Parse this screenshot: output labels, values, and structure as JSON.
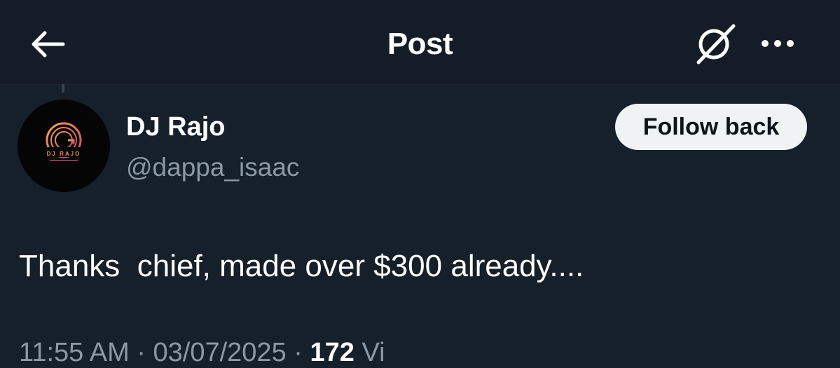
{
  "header": {
    "title": "Post",
    "back_icon": "arrow-left-icon",
    "grok_icon": "grok-icon",
    "more_icon": "more-horizontal-icon"
  },
  "post": {
    "author": {
      "display_name": "DJ Rajo",
      "handle": "@dappa_isaac",
      "avatar_logo_text": "DJ RAJO"
    },
    "follow_button_label": "Follow back",
    "text": "Thanks  chief, made over $300 already....",
    "meta": {
      "time": "11:55 AM",
      "separator": " · ",
      "date": "03/07/2025",
      "views_count": "172",
      "views_label": " Vi"
    }
  },
  "colors": {
    "background": "#15202b",
    "header_background": "#141d27",
    "text_primary": "#ffffff",
    "text_secondary": "#8b98a5",
    "button_background": "#eff3f4",
    "avatar_accent": "#f08a5d"
  }
}
